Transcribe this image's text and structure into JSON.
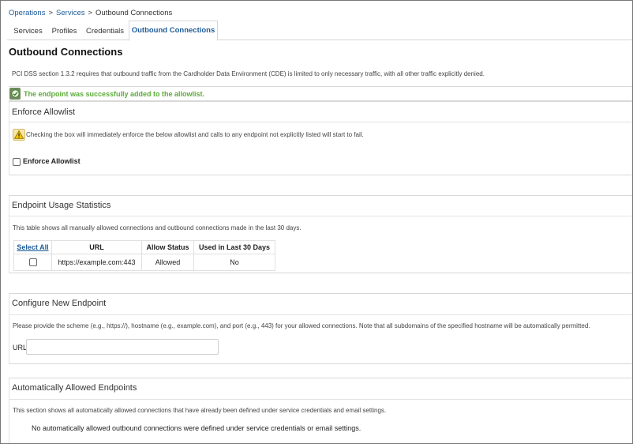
{
  "breadcrumb": {
    "items": [
      "Operations",
      "Services",
      "Outbound Connections"
    ],
    "separator": ">"
  },
  "tabs": [
    {
      "label": "Services"
    },
    {
      "label": "Profiles"
    },
    {
      "label": "Credentials"
    },
    {
      "label": "Outbound Connections",
      "active": true
    }
  ],
  "page": {
    "title": "Outbound Connections",
    "pci_text": "PCI DSS section 1.3.2 requires that outbound traffic from the Cardholder Data Environment (CDE) is limited to only necessary traffic, with all other traffic explicitly denied."
  },
  "success": {
    "message": "The endpoint was successfully added to the allowlist.",
    "color": "#5cab3a"
  },
  "enforce": {
    "heading": "Enforce Allowlist",
    "warning": "Checking the box will immediately enforce the below allowlist and calls to any endpoint not explicitly listed will start to fail.",
    "checkbox_label": "Enforce Allowlist",
    "checked": false
  },
  "stats": {
    "heading": "Endpoint Usage Statistics",
    "description": "This table shows all manually allowed connections and outbound connections made in the last 30 days.",
    "columns": [
      "Select All",
      "URL",
      "Allow Status",
      "Used in Last 30 Days"
    ],
    "rows": [
      {
        "checked": false,
        "url": "https://example.com:443",
        "status": "Allowed",
        "used": "No"
      }
    ]
  },
  "configure": {
    "heading": "Configure New Endpoint",
    "description": "Please provide the scheme (e.g., https://), hostname (e.g., example.com), and port (e.g., 443) for your allowed connections. Note that all subdomains of the specified hostname will be automatically permitted.",
    "url_label": "URL",
    "url_value": ""
  },
  "auto": {
    "heading": "Automatically Allowed Endpoints",
    "description": "This section shows all automatically allowed connections that have already been defined under service credentials and email settings.",
    "empty_message": "No automatically allowed outbound connections were defined under service credentials or email settings."
  },
  "colors": {
    "link": "#1d5c99",
    "success": "#5cab3a",
    "warning": "#f2c200"
  },
  "icons": {
    "success": "success-check-icon",
    "warning": "warning-icon"
  }
}
